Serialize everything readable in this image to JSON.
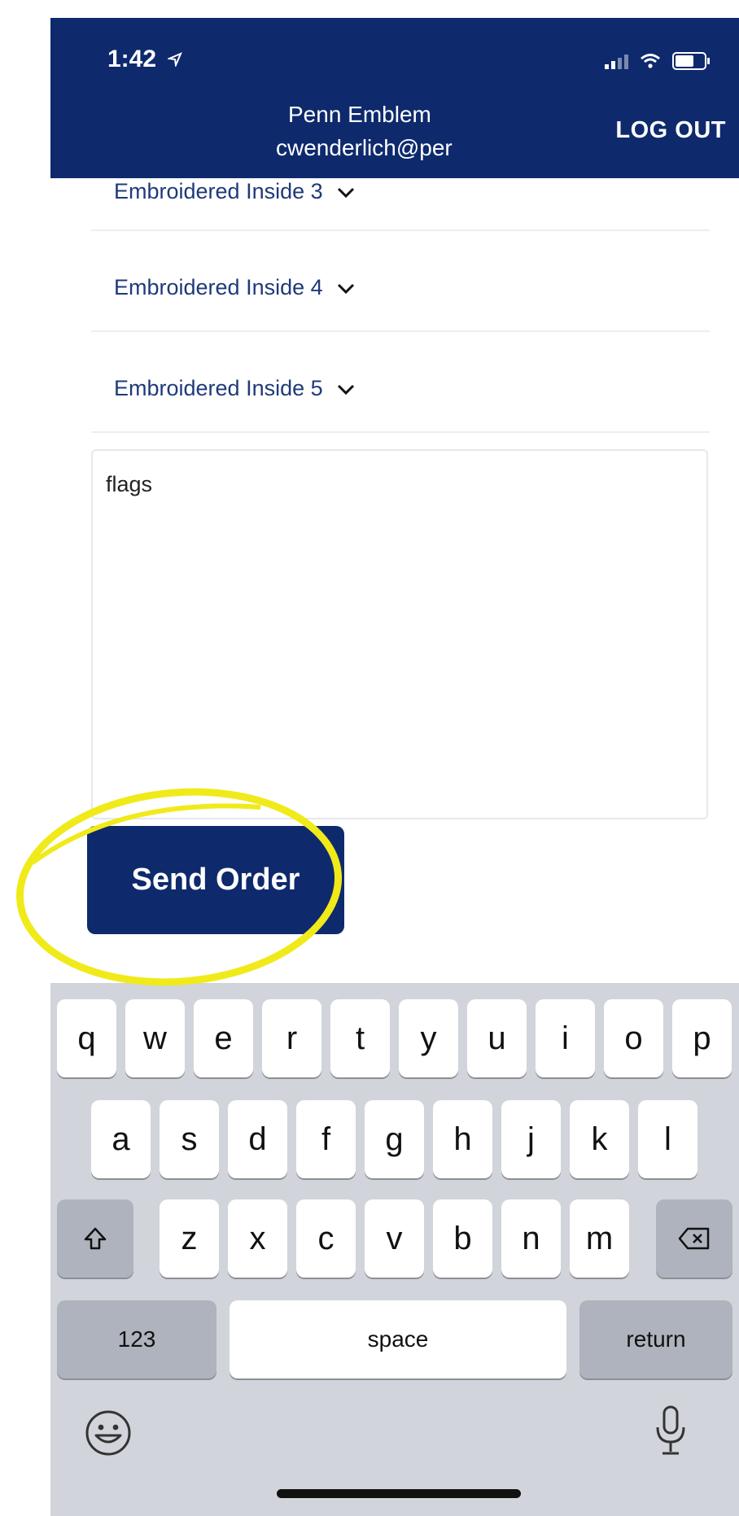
{
  "status_bar": {
    "time": "1:42"
  },
  "header": {
    "company": "Penn Emblem",
    "email": "cwenderlich@per",
    "logout_label": "LOG OUT"
  },
  "dropdowns": [
    {
      "label": "Embroidered Inside 3"
    },
    {
      "label": "Embroidered Inside 4"
    },
    {
      "label": "Embroidered Inside 5"
    }
  ],
  "notes": {
    "value": "flags"
  },
  "send_button": {
    "label": "Send Order"
  },
  "keyboard": {
    "row1": [
      "q",
      "w",
      "e",
      "r",
      "t",
      "y",
      "u",
      "i",
      "o",
      "p"
    ],
    "row2": [
      "a",
      "s",
      "d",
      "f",
      "g",
      "h",
      "j",
      "k",
      "l"
    ],
    "row3": [
      "z",
      "x",
      "c",
      "v",
      "b",
      "n",
      "m"
    ],
    "numbers_label": "123",
    "space_label": "space",
    "return_label": "return"
  },
  "colors": {
    "brand": "#0e2a6d",
    "highlight": "#f0ea1a",
    "link": "#1f3a7a"
  },
  "icons": [
    "location-arrow-icon",
    "signal-icon",
    "wifi-icon",
    "battery-icon",
    "chevron-down-icon",
    "shift-icon",
    "backspace-icon",
    "emoji-icon",
    "microphone-icon"
  ]
}
